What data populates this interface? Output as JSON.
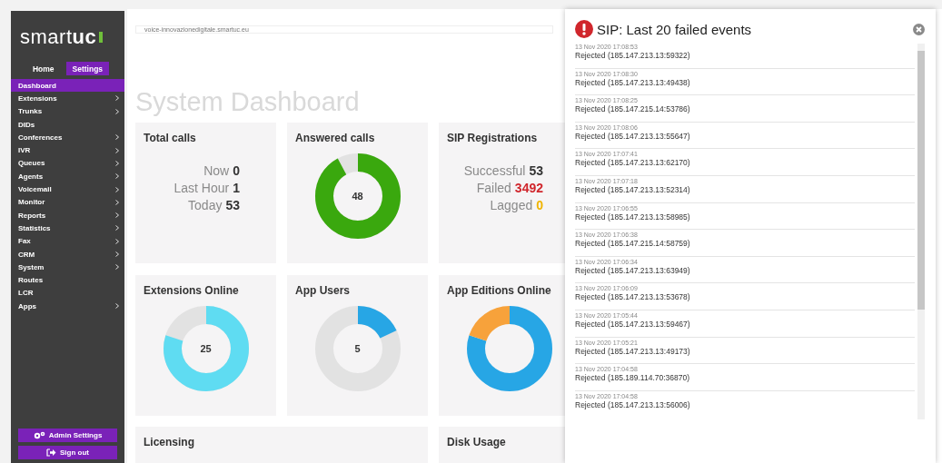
{
  "sidebar": {
    "logo": {
      "light": "smart",
      "bold": "uc"
    },
    "tabs": [
      {
        "label": "Home",
        "selected": false
      },
      {
        "label": "Settings",
        "selected": true
      }
    ],
    "items": [
      {
        "label": "Dashboard",
        "selected": true,
        "has_submenu": false
      },
      {
        "label": "Extensions",
        "selected": false,
        "has_submenu": true
      },
      {
        "label": "Trunks",
        "selected": false,
        "has_submenu": true
      },
      {
        "label": "DIDs",
        "selected": false,
        "has_submenu": false
      },
      {
        "label": "Conferences",
        "selected": false,
        "has_submenu": true
      },
      {
        "label": "IVR",
        "selected": false,
        "has_submenu": true
      },
      {
        "label": "Queues",
        "selected": false,
        "has_submenu": true
      },
      {
        "label": "Agents",
        "selected": false,
        "has_submenu": true
      },
      {
        "label": "Voicemail",
        "selected": false,
        "has_submenu": true
      },
      {
        "label": "Monitor",
        "selected": false,
        "has_submenu": true
      },
      {
        "label": "Reports",
        "selected": false,
        "has_submenu": true
      },
      {
        "label": "Statistics",
        "selected": false,
        "has_submenu": true
      },
      {
        "label": "Fax",
        "selected": false,
        "has_submenu": true
      },
      {
        "label": "CRM",
        "selected": false,
        "has_submenu": true
      },
      {
        "label": "System",
        "selected": false,
        "has_submenu": true
      },
      {
        "label": "Routes",
        "selected": false,
        "has_submenu": false
      },
      {
        "label": "LCR",
        "selected": false,
        "has_submenu": false
      },
      {
        "label": "Apps",
        "selected": false,
        "has_submenu": true
      }
    ],
    "buttons": [
      {
        "kind": "admin",
        "label": "Admin Settings"
      },
      {
        "kind": "signout",
        "label": "Sign out"
      }
    ]
  },
  "address": {
    "value": "voice-innovazionedigitale.smartuc.eu"
  },
  "title": "System Dashboard",
  "cards": [
    {
      "kind": "stats",
      "title": "Total calls",
      "rows": [
        {
          "label": "Now",
          "value": "0",
          "color": "#333333"
        },
        {
          "label": "Last Hour",
          "value": "1",
          "color": "#333333"
        },
        {
          "label": "Today",
          "value": "53",
          "color": "#333333"
        }
      ]
    },
    {
      "kind": "donut",
      "title": "Answered calls",
      "center": "48",
      "level": 0.92,
      "color": "#3aa80e"
    },
    {
      "kind": "stats",
      "title": "SIP Registrations",
      "rows": [
        {
          "label": "Successful",
          "value": "53",
          "color": "#333333"
        },
        {
          "label": "Failed",
          "value": "3492",
          "color": "#d0262c"
        },
        {
          "label": "Lagged",
          "value": "0",
          "color": "#f0b400"
        }
      ]
    },
    {
      "kind": "donut",
      "title": "Extensions Online",
      "center": "25",
      "level": 0.8,
      "color": "#5fdcf2"
    },
    {
      "kind": "donut",
      "title": "App Users",
      "center": "5",
      "level": 0.18,
      "color": "#27a6e5"
    },
    {
      "kind": "split",
      "title": "App Editions Online",
      "segments": [
        {
          "level": 0.8,
          "color": "#27a6e5"
        },
        {
          "level": 0.2,
          "color": "#f7a23b"
        }
      ]
    }
  ],
  "bottom_cards": [
    {
      "title": "Licensing",
      "wide": true
    },
    {
      "title": "Disk Usage",
      "wide": false
    }
  ],
  "modal": {
    "title": "SIP: Last 20 failed events",
    "events": [
      {
        "time": "13 Nov 2020 17:08:53",
        "text": "Rejected (185.147.213.13:59322)"
      },
      {
        "time": "13 Nov 2020 17:08:30",
        "text": "Rejected (185.147.213.13:49438)"
      },
      {
        "time": "13 Nov 2020 17:08:25",
        "text": "Rejected (185.147.215.14:53786)"
      },
      {
        "time": "13 Nov 2020 17:08:06",
        "text": "Rejected (185.147.213.13:55647)"
      },
      {
        "time": "13 Nov 2020 17:07:41",
        "text": "Rejected (185.147.213.13:62170)"
      },
      {
        "time": "13 Nov 2020 17:07:18",
        "text": "Rejected (185.147.213.13:52314)"
      },
      {
        "time": "13 Nov 2020 17:06:55",
        "text": "Rejected (185.147.213.13:58985)"
      },
      {
        "time": "13 Nov 2020 17:06:38",
        "text": "Rejected (185.147.215.14:58759)"
      },
      {
        "time": "13 Nov 2020 17:06:34",
        "text": "Rejected (185.147.213.13:63949)"
      },
      {
        "time": "13 Nov 2020 17:06:09",
        "text": "Rejected (185.147.213.13:53678)"
      },
      {
        "time": "13 Nov 2020 17:05:44",
        "text": "Rejected (185.147.213.13:59467)"
      },
      {
        "time": "13 Nov 2020 17:05:21",
        "text": "Rejected (185.147.213.13:49173)"
      },
      {
        "time": "13 Nov 2020 17:04:58",
        "text": "Rejected (185.189.114.70:36870)"
      },
      {
        "time": "13 Nov 2020 17:04:58",
        "text": "Rejected (185.147.213.13:56006)"
      }
    ]
  }
}
